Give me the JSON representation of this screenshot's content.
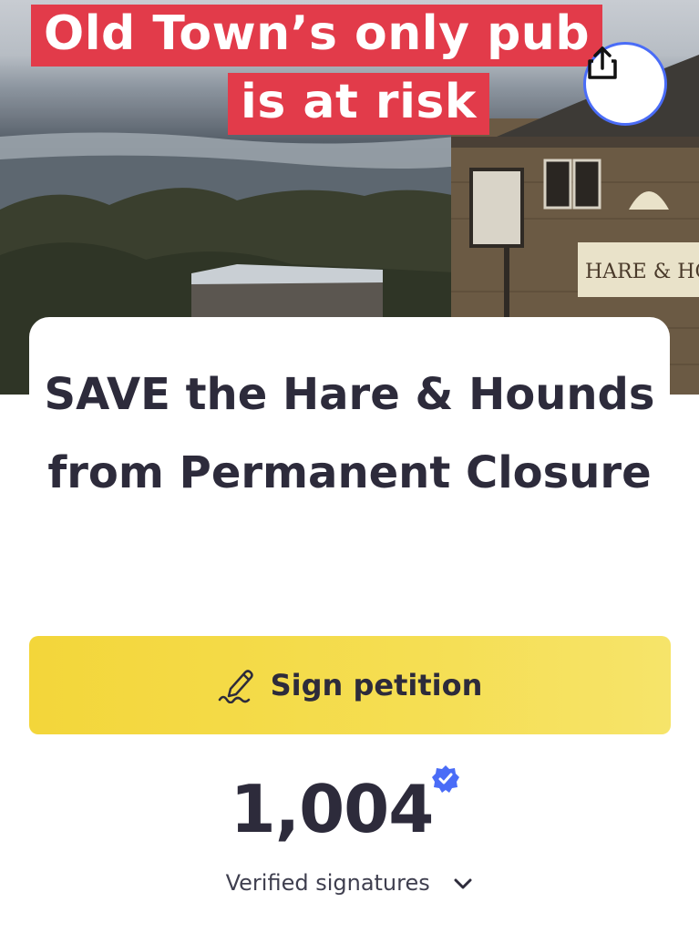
{
  "hero": {
    "overlay_line_1": "Old Town’s only pub",
    "overlay_line_2": "is at risk",
    "pub_sign_text": "HARE & HOUN",
    "share_icon": "share-icon"
  },
  "petition": {
    "title": "SAVE the Hare & Hounds from Permanent Closure"
  },
  "sign_button": {
    "label": "Sign petition",
    "icon": "signature-pen-icon"
  },
  "signatures": {
    "count": "1,004",
    "label": "Verified signatures",
    "badge_icon": "verified-badge-icon",
    "expand_icon": "chevron-down-icon"
  },
  "colors": {
    "overlay_red": "#e23b4a",
    "button_yellow": "#f5de52",
    "accent_blue": "#4a6cf7",
    "text_dark": "#2d2b3b"
  }
}
